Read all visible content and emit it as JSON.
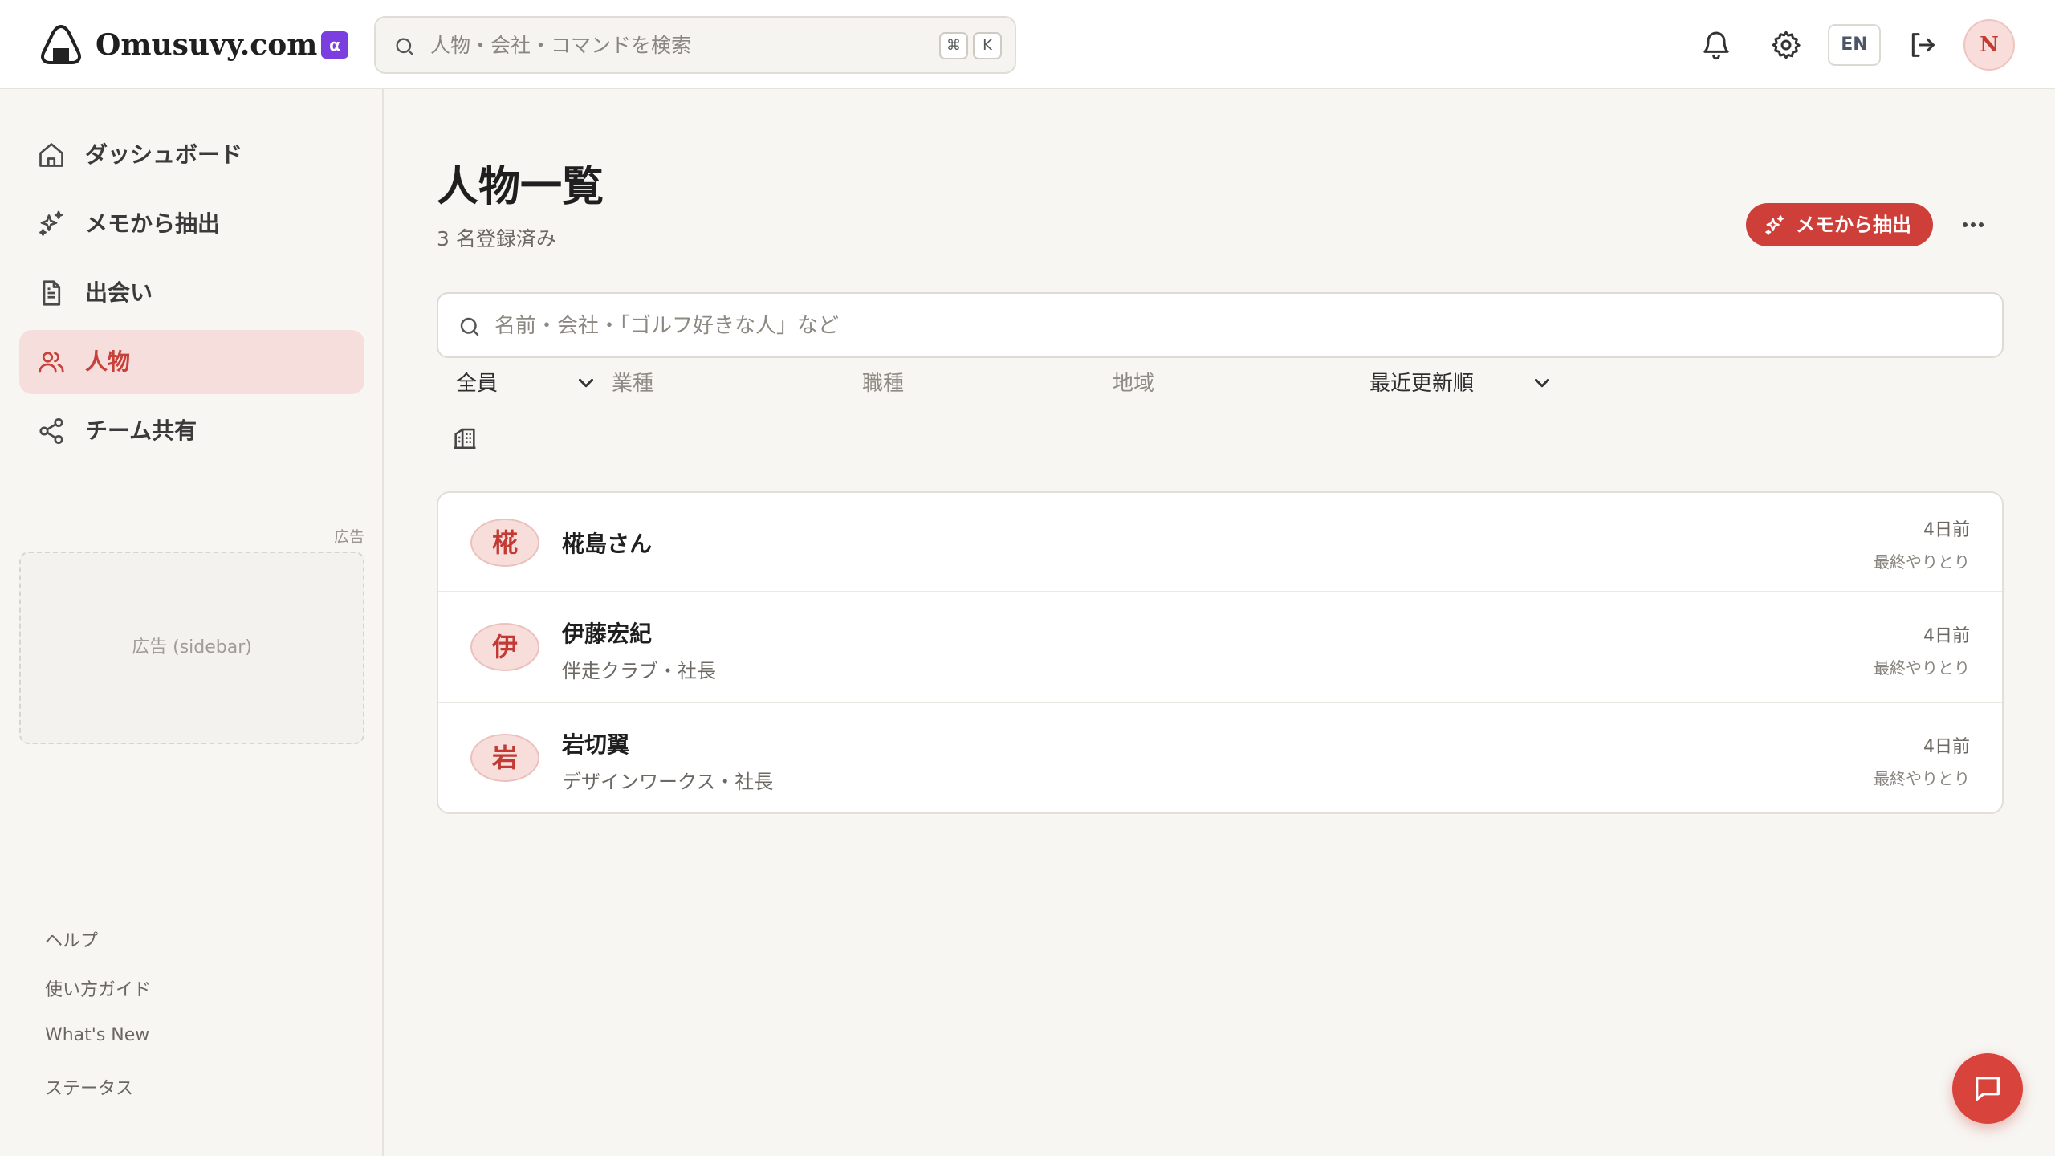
{
  "app": {
    "name": "Omusuvy.com",
    "badge": "α"
  },
  "header": {
    "search_placeholder": "人物・会社・コマンドを検索",
    "shortcut_keys": [
      "⌘",
      "K"
    ],
    "lang_label": "EN",
    "avatar_initial": "N"
  },
  "sidebar": {
    "items": [
      {
        "label": "ダッシュボード",
        "icon": "home-icon",
        "active": false
      },
      {
        "label": "メモから抽出",
        "icon": "sparkles-icon",
        "active": false
      },
      {
        "label": "出会い",
        "icon": "document-icon",
        "active": false
      },
      {
        "label": "人物",
        "icon": "users-icon",
        "active": true
      },
      {
        "label": "チーム共有",
        "icon": "share-icon",
        "active": false
      }
    ],
    "ad_label": "広告",
    "ad_text": "広告 (sidebar)",
    "footer_links": [
      "ヘルプ",
      "使い方ガイド",
      "What's New",
      "ステータス"
    ]
  },
  "main": {
    "title": "人物一覧",
    "subtitle": "3 名登録済み",
    "extract_button": "メモから抽出",
    "search_placeholder": "名前・会社・「ゴルフ好きな人」など",
    "filters": {
      "scope": "全員",
      "industry_placeholder": "業種",
      "job_placeholder": "職種",
      "region_placeholder": "地域",
      "sort": "最近更新順"
    },
    "people": [
      {
        "initial": "椛",
        "name": "椛島さん",
        "subtitle": "",
        "time": "4日前",
        "meta": "最終やりとり"
      },
      {
        "initial": "伊",
        "name": "伊藤宏紀",
        "subtitle": "伴走クラブ・社長",
        "time": "4日前",
        "meta": "最終やりとり"
      },
      {
        "initial": "岩",
        "name": "岩切翼",
        "subtitle": "デザインワークス・社長",
        "time": "4日前",
        "meta": "最終やりとり"
      }
    ]
  },
  "colors": {
    "accent": "#cf3f39",
    "active_bg": "#f6dedc",
    "badge": "#7b3fe0",
    "background": "#f7f6f3"
  }
}
